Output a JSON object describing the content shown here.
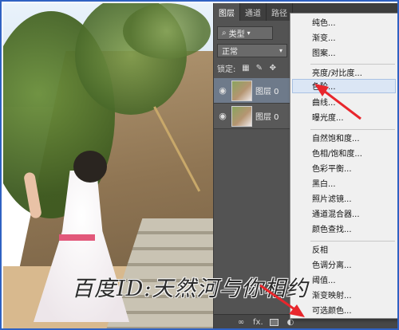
{
  "panel": {
    "tabs": [
      "图层",
      "通道",
      "路径"
    ],
    "filter": {
      "label": "类型",
      "icon": "search-icon"
    },
    "blend_mode": "正常",
    "lock_label": "锁定:",
    "lock_icons": [
      "lock-transparent-icon",
      "lock-brush-icon",
      "lock-move-icon"
    ],
    "layers": [
      {
        "name": "图层 0",
        "selected": true
      },
      {
        "name": "图层 0",
        "selected": false
      }
    ],
    "footer": {
      "fx_label": "fx."
    }
  },
  "menu": {
    "items": [
      "纯色...",
      "渐变...",
      "图案...",
      "亮度/对比度...",
      "色阶...",
      "曲线...",
      "曝光度...",
      "自然饱和度...",
      "色相/饱和度...",
      "色彩平衡...",
      "黑白...",
      "照片滤镜...",
      "通道混合器...",
      "颜色查找...",
      "反相",
      "色调分离...",
      "阈值...",
      "渐变映射...",
      "可选颜色..."
    ],
    "highlighted": "色阶..."
  },
  "watermark": "百度ID:天然河与你相约",
  "colors": {
    "arrow": "#e8262c",
    "frame": "#2f61c2",
    "menu_highlight": "#dbe6f5"
  }
}
